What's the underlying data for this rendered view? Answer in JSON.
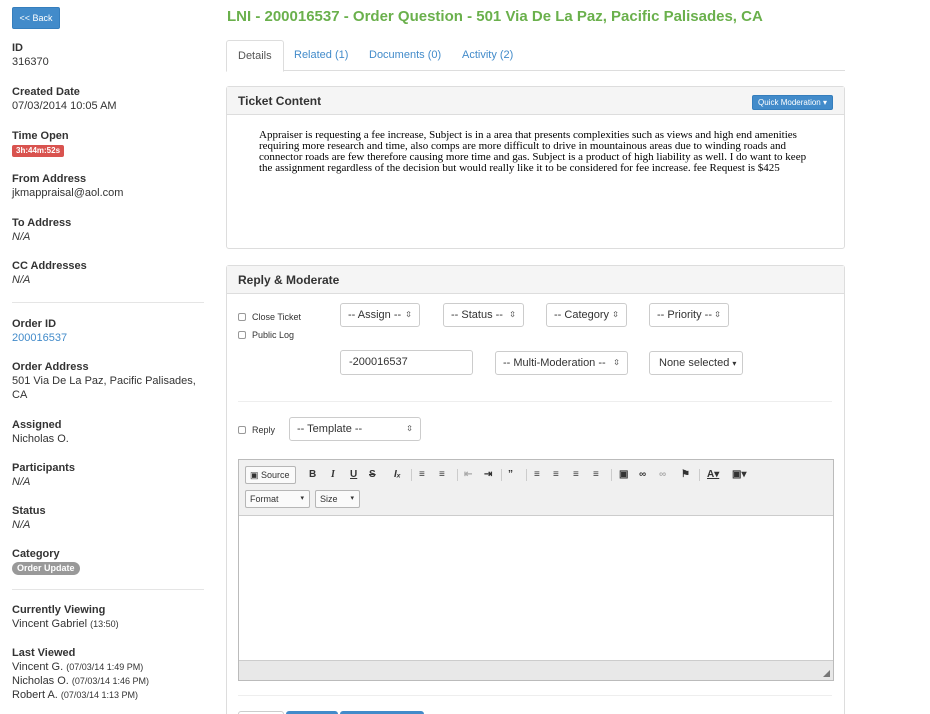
{
  "sidebar": {
    "back_label": "<< Back",
    "id": {
      "label": "ID",
      "value": "316370"
    },
    "created": {
      "label": "Created Date",
      "value": "07/03/2014 10:05 AM"
    },
    "time_open": {
      "label": "Time Open",
      "value": "3h:44m:52s"
    },
    "from": {
      "label": "From Address",
      "value": "jkmappraisal@aol.com"
    },
    "to": {
      "label": "To Address",
      "value": "N/A"
    },
    "cc": {
      "label": "CC Addresses",
      "value": "N/A"
    },
    "order_id": {
      "label": "Order ID",
      "value": "200016537"
    },
    "order_address": {
      "label": "Order Address",
      "value": "501 Via De La Paz, Pacific Palisades, CA"
    },
    "assigned": {
      "label": "Assigned",
      "value": "Nicholas O."
    },
    "participants": {
      "label": "Participants",
      "value": "N/A"
    },
    "status": {
      "label": "Status",
      "value": "N/A"
    },
    "category": {
      "label": "Category",
      "value": "Order Update"
    },
    "currently_viewing": {
      "label": "Currently Viewing",
      "name": "Vincent Gabriel",
      "time": "(13:50)"
    },
    "last_viewed": {
      "label": "Last Viewed",
      "entries": [
        {
          "name": "Vincent G.",
          "time": "(07/03/14 1:49 PM)"
        },
        {
          "name": "Nicholas O.",
          "time": "(07/03/14 1:46 PM)"
        },
        {
          "name": "Robert A.",
          "time": "(07/03/14 1:13 PM)"
        }
      ]
    }
  },
  "header": {
    "title": "LNI - 200016537 - Order Question - 501 Via De La Paz, Pacific Palisades, CA"
  },
  "tabs": [
    {
      "label": "Details"
    },
    {
      "label": "Related (1)"
    },
    {
      "label": "Documents (0)"
    },
    {
      "label": "Activity (2)"
    }
  ],
  "ticket": {
    "heading": "Ticket Content",
    "quick_moderation": "Quick Moderation",
    "body": "Appraiser is requesting a fee increase, Subject is in a area that presents complexities such as views and high end amenities requiring more research and time, also comps are more difficult to drive in mountainous areas due to winding roads and connector roads are few therefore causing more time and gas. Subject is a product of high liability as well. I do want to keep the assignment regardless of the decision but would really like it to be considered for fee increase. fee Request is $425"
  },
  "reply": {
    "heading": "Reply & Moderate",
    "close_ticket": "Close Ticket",
    "public_log": "Public Log",
    "assign": "-- Assign --",
    "status": "-- Status --",
    "category": "-- Category -",
    "priority": "-- Priority --",
    "order_input": "-200016537",
    "multi_moderation": "-- Multi-Moderation --",
    "none_selected": "None selected",
    "reply_label": "Reply",
    "template": "-- Template --"
  },
  "editor": {
    "source": "Source",
    "format": "Format",
    "size": "Size"
  },
  "colors": {
    "title_green": "#6ab04c",
    "link_blue": "#428bca",
    "danger_red": "#d9534f"
  }
}
